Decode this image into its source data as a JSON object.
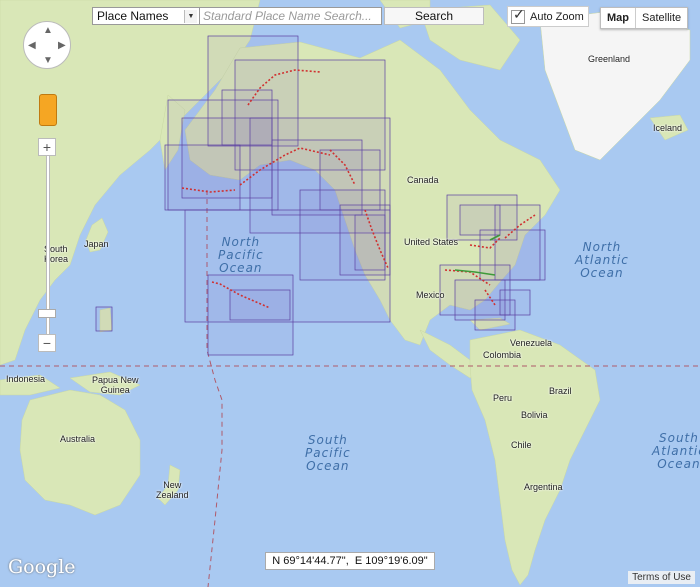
{
  "toolbar": {
    "place_select_value": "Place Names",
    "search_placeholder": "Standard Place Name Search...",
    "search_button": "Search",
    "auto_zoom_label": "Auto Zoom",
    "auto_zoom_checked": true
  },
  "map_type": {
    "options": [
      "Map",
      "Satellite"
    ],
    "selected": "Map"
  },
  "zoom": {
    "plus_label": "+",
    "minus_label": "−",
    "level_fraction": 0.86
  },
  "ocean_labels": {
    "north_pacific": "North\nPacific\nOcean",
    "north_atlantic": "North\nAtlantic\nOcean",
    "south_pacific": "South\nPacific\nOcean",
    "south_atlantic": "South\nAtlantic\nOcean"
  },
  "place_labels": {
    "greenland": "Greenland",
    "iceland": "Iceland",
    "canada": "Canada",
    "united_states": "United States",
    "mexico": "Mexico",
    "venezuela": "Venezuela",
    "colombia": "Colombia",
    "brazil": "Brazil",
    "peru": "Peru",
    "bolivia": "Bolivia",
    "chile": "Chile",
    "argentina": "Argentina",
    "japan": "Japan",
    "south_korea": "South\nKorea",
    "indonesia": "Indonesia",
    "papua_new_guinea": "Papua New\nGuinea",
    "australia": "Australia",
    "new_zealand": "New\nZealand"
  },
  "coordinates": {
    "lat": "N 69°14'44.77\"",
    "separator": ",",
    "lon": "E 109°19'6.09\""
  },
  "logo": "Google",
  "terms": "Terms of Use",
  "colors": {
    "water": "#a9c9f1",
    "land": "#d9e7b7",
    "ice": "#f5f5f5",
    "chart_outline": "#5b3fa0",
    "marker_red": "#d03030",
    "marker_green": "#3e9a3a"
  }
}
